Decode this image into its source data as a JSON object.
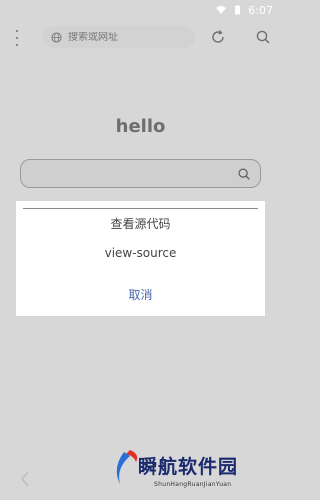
{
  "status_bar": {
    "time": "6:07"
  },
  "toolbar": {
    "menu_icon": "more-vertical-icon",
    "url_placeholder": "搜索或网址",
    "refresh_icon": "refresh-icon",
    "search_icon": "search-icon"
  },
  "page": {
    "heading": "hello",
    "search_placeholder": ""
  },
  "dialog": {
    "items": [
      "查看源代码",
      "view-source"
    ],
    "cancel_label": "取消"
  },
  "watermark": {
    "title": "瞬航软件园",
    "subtitle": "ShunHangRuanJianYuan"
  },
  "colors": {
    "dim_background": "#d7d7d7",
    "dialog_background": "#ffffff",
    "cancel_text": "#4a67a8"
  }
}
